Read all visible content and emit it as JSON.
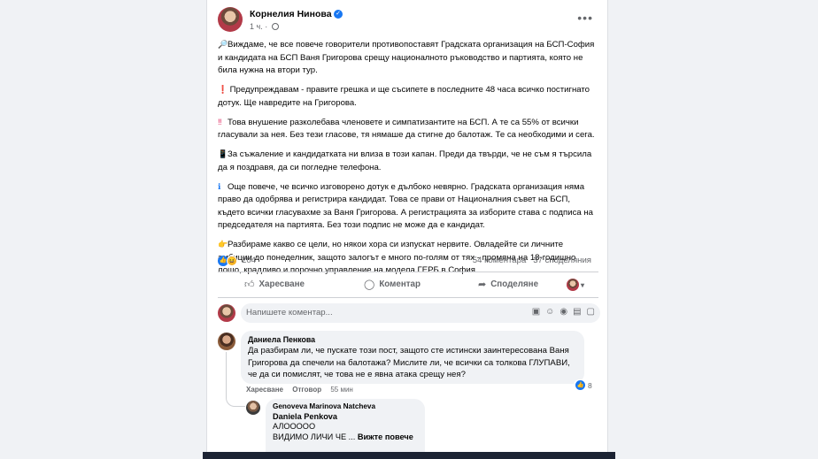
{
  "post": {
    "author": "Корнелия Нинова",
    "time": "1 ч.",
    "paragraphs": [
      {
        "emoji": "🔎",
        "text": "Виждаме, че все повече говорители противопоставят Градската организация на БСП-София и кандидата на БСП Ваня Григорова  срещу националното ръководство и партията, която не била нужна на втори тур."
      },
      {
        "emoji": "❗",
        "text": " Предупреждавам - правите грешка и ще съсипете в последните 48 часа всичко постигнато дотук. Ще навредите на Григорова."
      },
      {
        "emoji": "‼",
        "text": "Това внушение разколебава членовете и симпатизантите на БСП. А те са 55% от всички гласували за нея. Без тези гласове, тя нямаше да стигне до балотаж. Те са необходими и сега."
      },
      {
        "emoji": "📱",
        "text": "За съжаление и кандидатката ни влиза в този капан. Преди да твърди, че не съм я търсила да я поздравя, да си погледне телефона."
      },
      {
        "emoji": "ℹ",
        "text": "Още повече, че всичко изговорено дотук е дълбоко невярно. Градската организация няма право да одобрява и регистрира кандидат. Това се прави от Националния съвет на БСП, където всички гласувахме за  Ваня Григорова. А регистрацията  за изборите става с подписа на председателя на партията. Без този подпис не може да е кандидат."
      },
      {
        "emoji": "👉",
        "text": "Разбираме какво се цели, но някои хора си  изпускат нервите. Овладейте  си личните амбиции до понеделник, защото залогът е много по-голям от тях - промяна на 18-годишно лошо, крадливо и порочно управление на модела ГЕРБ в София."
      }
    ],
    "reactions_count": "204",
    "comments_count": "54 коментара",
    "shares_count": "37 споделяния"
  },
  "actions": {
    "like": "Харесване",
    "comment": "Коментар",
    "share": "Споделяне"
  },
  "composer": {
    "placeholder": "Напишете коментар..."
  },
  "comments": [
    {
      "author": "Даниела Пенкова",
      "text": "Да разбирам ли, че пускате този пост, защото сте истински заинтересована Ваня Григорова да спечели на балотажа? Мислите ли, че всички са толкова ГЛУПАВИ, че да си помислят, че това не е явна атака срещу нея?",
      "like_label": "Харесване",
      "reply_label": "Отговор",
      "time": "55 мин",
      "reactions": "8"
    },
    {
      "author": "Genoveva Marinova Natcheva",
      "mention": "Daniela Penkova",
      "line1": "АЛООООО",
      "line2": "ВИДИМО ЛИЧИ ЧЕ ...",
      "see_more": "Вижте повече"
    }
  ]
}
